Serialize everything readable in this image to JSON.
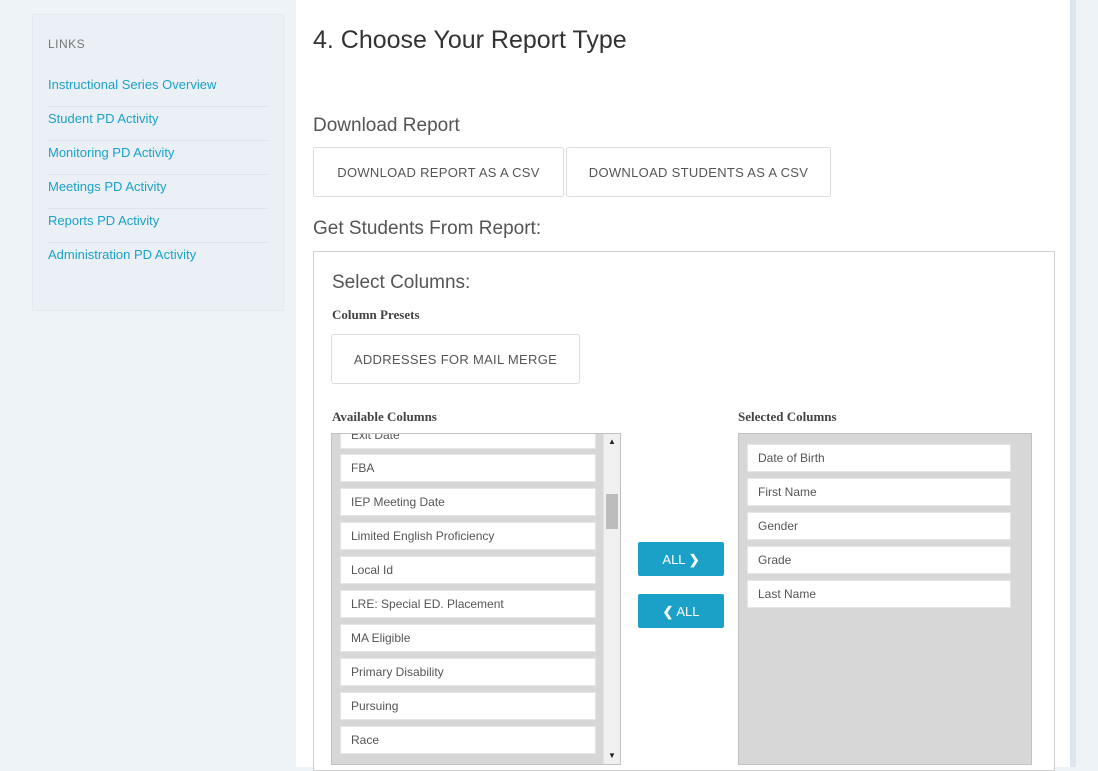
{
  "sidebar": {
    "title": "LINKS",
    "links": [
      "Instructional Series Overview",
      "Student PD Activity",
      "Monitoring PD Activity",
      "Meetings PD Activity",
      "Reports PD Activity",
      "Administration PD Activity"
    ]
  },
  "main": {
    "title": "4. Choose Your Report Type",
    "download": {
      "heading": "Download Report",
      "report_csv_button": "DOWNLOAD REPORT AS A CSV",
      "students_csv_button": "DOWNLOAD STUDENTS AS A CSV"
    },
    "students_heading": "Get Students From Report:",
    "columns": {
      "title": "Select Columns:",
      "presets_label": "Column Presets",
      "preset_button": "ADDRESSES FOR MAIL MERGE",
      "available_label": "Available Columns",
      "selected_label": "Selected Columns",
      "available": [
        "Exit Date",
        "FBA",
        "IEP Meeting Date",
        "Limited English Proficiency",
        "Local Id",
        "LRE: Special ED. Placement",
        "MA Eligible",
        "Primary Disability",
        "Pursuing",
        "Race"
      ],
      "selected": [
        "Date of Birth",
        "First Name",
        "Gender",
        "Grade",
        "Last Name"
      ],
      "add_all_button": "ALL",
      "remove_all_button": "ALL",
      "scroll_up_icon": "triangle-up",
      "scroll_down_icon": "triangle-down"
    }
  },
  "colors": {
    "accent": "#1ba1c8",
    "list_background": "#d7d7d7",
    "sidebar_background": "#eaf0f6"
  }
}
